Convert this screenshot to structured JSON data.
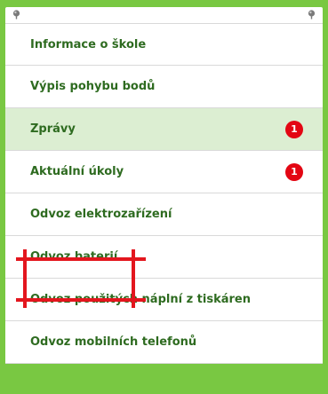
{
  "menu": {
    "items": [
      {
        "label": "Informace o škole"
      },
      {
        "label": "Výpis pohybu bodů"
      },
      {
        "label": "Zprávy",
        "badge": "1",
        "active": true
      },
      {
        "label": "Aktuální úkoly",
        "badge": "1"
      },
      {
        "label": "Odvoz elektrozařízení"
      },
      {
        "label": "Odvoz baterií",
        "highlighted": true
      },
      {
        "label": "Odvoz použitých náplní z tiskáren"
      },
      {
        "label": "Odvoz mobilních telefonů"
      }
    ]
  },
  "colors": {
    "frame_green": "#79c842",
    "text_green": "#2e6b20",
    "active_bg": "#dceed2",
    "badge_red": "#e30613",
    "highlight_red": "#e3161e"
  },
  "icons": {
    "pin_left": "pushpin-icon",
    "pin_right": "pushpin-icon"
  }
}
